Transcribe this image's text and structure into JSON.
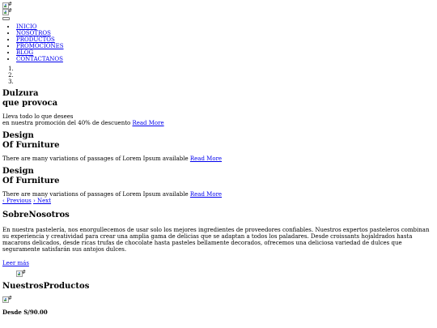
{
  "header": {
    "logo_alt": "#",
    "logo2_alt": "#"
  },
  "nav": {
    "items": [
      {
        "label": "INICIO"
      },
      {
        "label": "NOSOTROS"
      },
      {
        "label": "PRODUCTOS"
      },
      {
        "label": "PROMOCIONES"
      },
      {
        "label": "BLOG"
      },
      {
        "label": "CONTACTANOS"
      }
    ]
  },
  "carousel": {
    "indicators": [
      "",
      "",
      ""
    ],
    "slides": [
      {
        "title_line1": "Dulzura",
        "title_line2": "que provoca",
        "text_line1": "Lleva todo lo que desees",
        "text_line2": "en nuestra promoción del 40% de descuento",
        "link": "Read More"
      },
      {
        "title_line1": "Design",
        "title_line2": "Of Furniture",
        "text_line1": "There are many variations of passages of Lorem Ipsum available",
        "link": "Read More"
      },
      {
        "title_line1": "Design",
        "title_line2": "Of Furniture",
        "text_line1": "There are many variations of passages of Lorem Ipsum available",
        "link": "Read More"
      }
    ],
    "prev_label": "‹ Previous",
    "next_label": "› Next"
  },
  "about": {
    "title": "SobreNosotros",
    "text": "En nuestra pastelería, nos enorgullecemos de usar solo los mejores ingredientes de proveedores confiables. Nuestros expertos pasteleros combinan su experiencia y creatividad para crear una amplia gama de delicias que se adaptan a todos los paladares. Desde croissants hojaldrados hasta macarons delicados, desde ricas trufas de chocolate hasta pasteles bellamente decorados, ofrecemos una deliciosa variedad de dulces que seguramente satisfarán sus antojos dulces.",
    "link": "Leer más",
    "image_alt": "#"
  },
  "products": {
    "title": "NuestrosProductos",
    "image_alt": "#",
    "price": "Desde S/90.00"
  }
}
